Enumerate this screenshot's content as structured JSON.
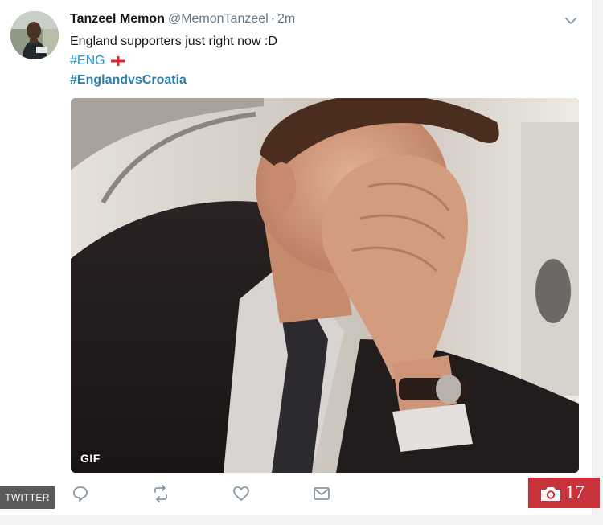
{
  "tweet": {
    "display_name": "Tanzeel Memon",
    "handle": "@MemonTanzeel",
    "separator": "·",
    "time": "2m",
    "text": "England supporters just right now :D",
    "hashtags": [
      "#ENG",
      "#EnglandvsCroatia"
    ],
    "media_badge": "GIF",
    "link_color": "#1b95e0"
  },
  "source_label": "TWITTER",
  "gallery": {
    "photo_count": "17",
    "accent": "#c8323a"
  },
  "icons": {
    "reply": "reply-icon",
    "retweet": "retweet-icon",
    "like": "heart-icon",
    "dm": "envelope-icon",
    "caret": "chevron-down-icon",
    "camera": "camera-icon",
    "flag": "england-flag-icon"
  }
}
